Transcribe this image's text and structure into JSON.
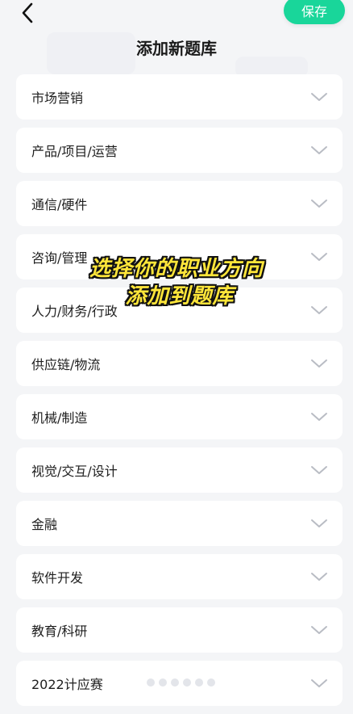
{
  "header": {
    "title": "添加新题库",
    "save_label": "保存",
    "back_icon": "chevron-left-icon"
  },
  "colors": {
    "accent": "#19d69a",
    "background": "#f4f5f7",
    "overlay_text": "#ffe63a"
  },
  "categories": [
    {
      "label": "市场营销"
    },
    {
      "label": "产品/项目/运营"
    },
    {
      "label": "通信/硬件"
    },
    {
      "label": "咨询/管理"
    },
    {
      "label": "人力/财务/行政"
    },
    {
      "label": "供应链/物流"
    },
    {
      "label": "机械/制造"
    },
    {
      "label": "视觉/交互/设计"
    },
    {
      "label": "金融"
    },
    {
      "label": "软件开发"
    },
    {
      "label": "教育/科研"
    },
    {
      "label": "2022计应赛"
    }
  ],
  "overlay": {
    "line1": "选择你的职业方向",
    "line2": "添加到题库"
  }
}
